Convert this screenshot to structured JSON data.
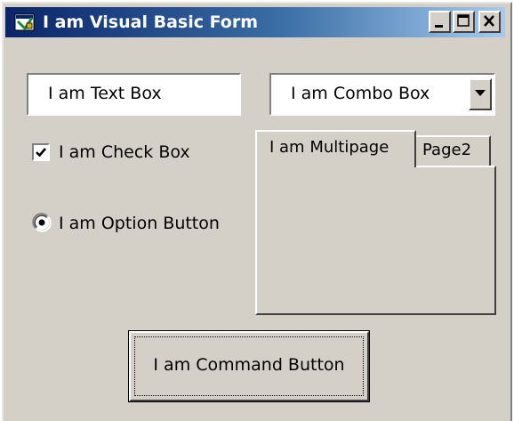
{
  "window": {
    "title": "I am Visual Basic Form",
    "controls": {
      "minimize_icon": "minimize-icon",
      "maximize_icon": "maximize-icon",
      "close_icon": "close-icon"
    }
  },
  "form": {
    "text_box": {
      "value": "I am Text Box"
    },
    "combo_box": {
      "value": "I am Combo Box",
      "dropdown_icon": "chevron-down-icon"
    },
    "check_box": {
      "label": "I am Check Box",
      "checked": true
    },
    "option_button": {
      "label": "I am Option Button",
      "selected": true
    },
    "multipage": {
      "tabs": [
        {
          "label": "I am Multipage",
          "active": true
        },
        {
          "label": "Page2",
          "active": false
        }
      ]
    },
    "command_button": {
      "label": "I am Command Button"
    }
  },
  "colors": {
    "face": "#d4d0c8",
    "titlebar_start": "#0a246a",
    "titlebar_end": "#a6caf0",
    "title_text": "#ffffff"
  }
}
